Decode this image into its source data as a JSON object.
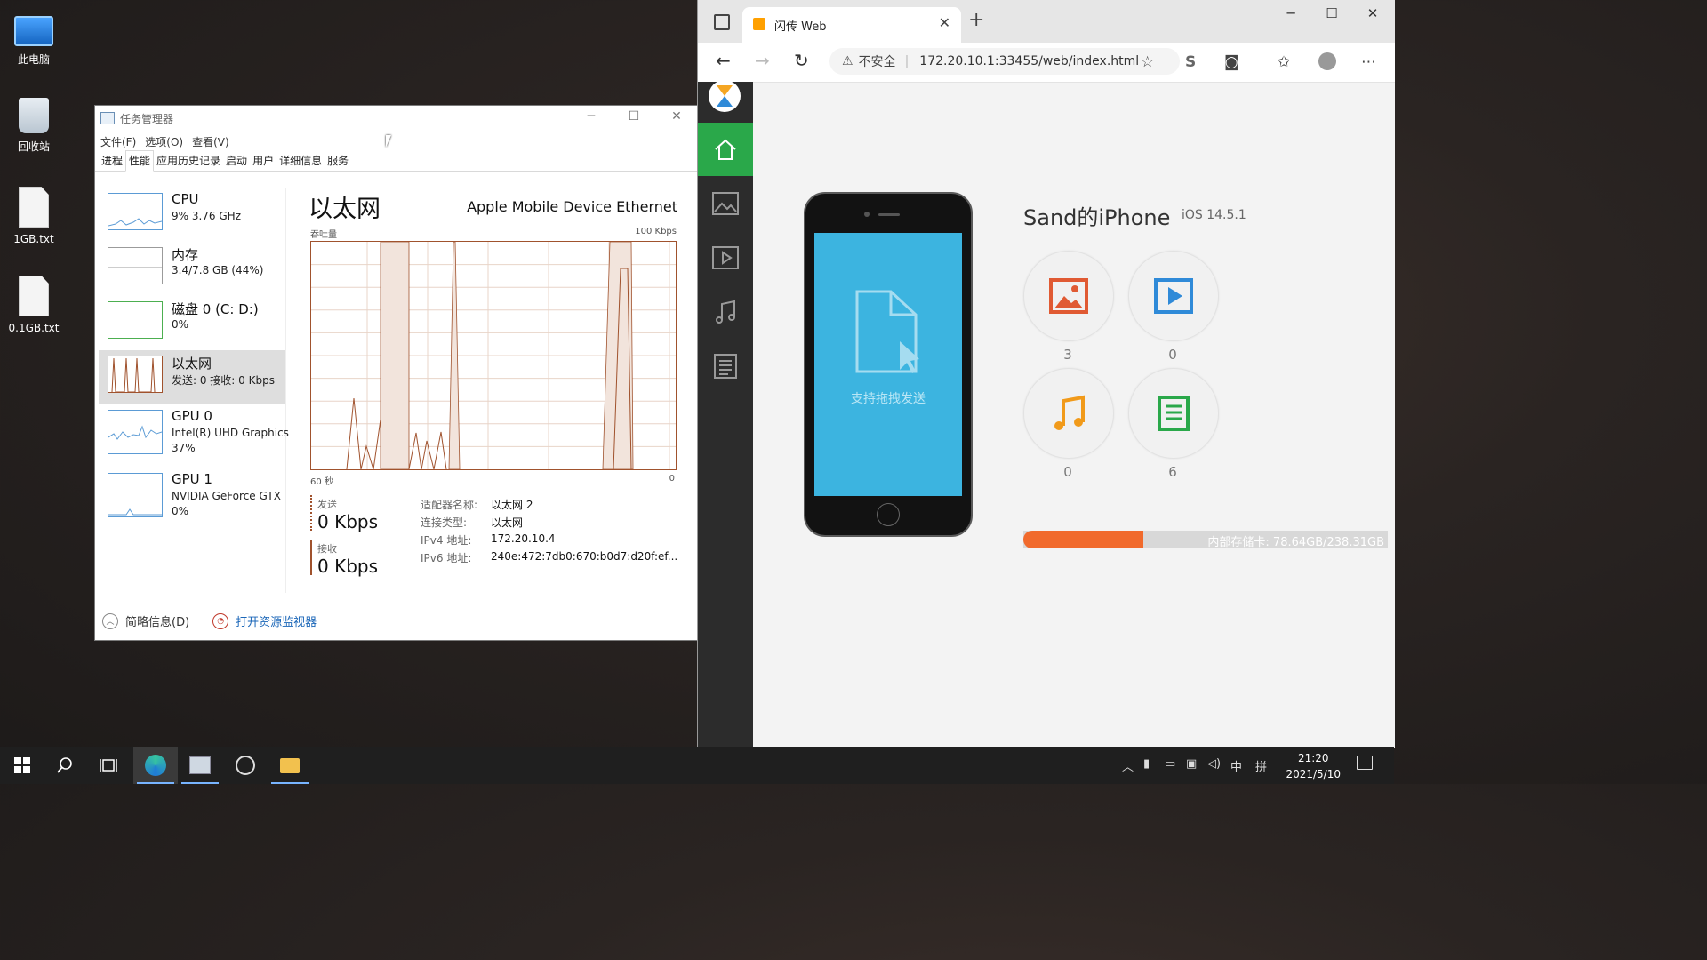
{
  "desktop": {
    "icons": [
      {
        "label": "此电脑",
        "icon": "computer-icon"
      },
      {
        "label": "回收站",
        "icon": "recycle-bin-icon"
      },
      {
        "label": "1GB.txt",
        "icon": "text-file-icon"
      },
      {
        "label": "0.1GB.txt",
        "icon": "text-file-icon"
      }
    ]
  },
  "task_manager": {
    "title": "任务管理器",
    "menu": [
      "文件(F)",
      "选项(O)",
      "查看(V)"
    ],
    "tabs": [
      "进程",
      "性能",
      "应用历史记录",
      "启动",
      "用户",
      "详细信息",
      "服务"
    ],
    "active_tab": "性能",
    "resources": [
      {
        "name": "CPU",
        "line1": "9% 3.76 GHz",
        "line2": ""
      },
      {
        "name": "内存",
        "line1": "3.4/7.8 GB (44%)",
        "line2": ""
      },
      {
        "name": "磁盘 0 (C: D:)",
        "line1": "0%",
        "line2": ""
      },
      {
        "name": "以太网",
        "line1": "发送: 0 接收: 0 Kbps",
        "line2": ""
      },
      {
        "name": "GPU 0",
        "line1": "Intel(R) UHD Graphics",
        "line2": "37%"
      },
      {
        "name": "GPU 1",
        "line1": "NVIDIA GeForce GTX",
        "line2": "0%"
      }
    ],
    "selected_resource": "以太网",
    "detail": {
      "title": "以太网",
      "adapter": "Apple Mobile Device Ethernet",
      "throughput_label": "吞吐量",
      "max_label": "100 Kbps",
      "time_label": "60 秒",
      "zero_label": "0",
      "send_label": "发送",
      "send_value": "0 Kbps",
      "recv_label": "接收",
      "recv_value": "0 Kbps",
      "props": [
        {
          "key": "适配器名称:",
          "value": "以太网 2"
        },
        {
          "key": "连接类型:",
          "value": "以太网"
        },
        {
          "key": "IPv4 地址:",
          "value": "172.20.10.4"
        },
        {
          "key": "IPv6 地址:",
          "value": "240e:472:7db0:670:b0d7:d20f:ef..."
        }
      ]
    },
    "footer": {
      "summary": "简略信息(D)",
      "monitor": "打开资源监视器"
    }
  },
  "browser": {
    "tab_title": "闪传 Web",
    "insecure": "不安全",
    "url": "172.20.10.1:33455/web/index.html",
    "device": {
      "name": "Sand的iPhone",
      "os": "iOS 14.5.1",
      "drop_text": "支持拖拽发送",
      "categories": [
        {
          "name": "photos",
          "icon": "image-icon",
          "count": "3",
          "color": "#e05a33"
        },
        {
          "name": "videos",
          "icon": "video-icon",
          "count": "0",
          "color": "#2f8ad8"
        },
        {
          "name": "music",
          "icon": "music-icon",
          "count": "0",
          "color": "#f19a1a"
        },
        {
          "name": "documents",
          "icon": "document-icon",
          "count": "6",
          "color": "#2aa84a"
        }
      ],
      "storage_text": "内部存储卡: 78.64GB/238.31GB",
      "storage_fraction": 0.33
    }
  },
  "taskbar": {
    "time": "21:20",
    "date": "2021/5/10",
    "ime": "中"
  }
}
